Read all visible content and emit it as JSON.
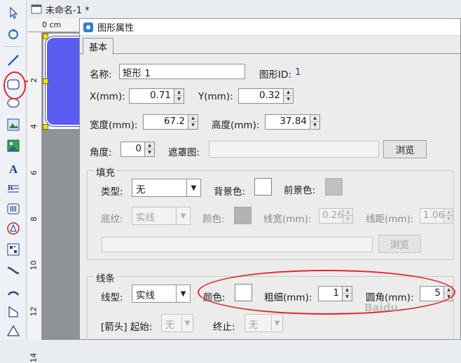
{
  "document": {
    "tab_title": "未命名-1 *"
  },
  "rulers": {
    "top_unit": "0 cm",
    "left_ticks": [
      "2",
      "4",
      "6",
      "8",
      "10",
      "12",
      "14"
    ]
  },
  "toolbar": {
    "tools": [
      "select-tool",
      "pan-tool",
      "line-tool",
      "rectangle-tool",
      "ellipse-tool",
      "image-tool",
      "picture-tool",
      "text-tool",
      "rich-text-tool",
      "barcode-tool",
      "seal-tool",
      "qrcode-tool",
      "curve-tool",
      "arc-tool",
      "polygon-tool",
      "triangle-tool"
    ]
  },
  "dialog": {
    "title": "图形属性",
    "tab": "基本",
    "name_label": "名称:",
    "name_value": "矩形 1",
    "id_label": "图形ID:",
    "id_value": "1",
    "x_label": "X(mm):",
    "x_value": "0.71",
    "y_label": "Y(mm):",
    "y_value": "0.32",
    "width_label": "宽度(mm):",
    "width_value": "67.2",
    "height_label": "高度(mm):",
    "height_value": "37.84",
    "angle_label": "角度:",
    "angle_value": "0",
    "mask_label": "遮罩图:",
    "mask_value": "",
    "browse_label": "浏览",
    "fill": {
      "title": "填充",
      "type_label": "类型:",
      "type_value": "无",
      "bg_color_label": "背景色:",
      "bg_color": "#ffffff",
      "fg_color_label": "前景色:",
      "fg_color": "#c0c0c0",
      "pattern_label": "底纹:",
      "pattern_value": "实线",
      "color_label": "颜色:",
      "color": "#b3b3b3",
      "line_width_label": "线宽(mm):",
      "line_width_value": "0.26",
      "line_spacing_label": "线距(mm):",
      "line_spacing_value": "1.06",
      "image_path": "",
      "browse_label": "浏览"
    },
    "stroke": {
      "title": "线条",
      "type_label": "线型:",
      "type_value": "实线",
      "color_label": "颜色:",
      "color": "#ffffff",
      "thickness_label": "粗细(mm):",
      "thickness_value": "1",
      "radius_label": "圆角(mm):",
      "radius_value": "5",
      "arrow_label": "[箭头] 起始:",
      "arrow_start": "无",
      "arrow_end_label": "终止:",
      "arrow_end": "无"
    }
  },
  "colors": {
    "shape_fill": "#5b5cf0",
    "annotation": "#e3262c",
    "handle": "#f4e500"
  },
  "watermark": "Baidu"
}
